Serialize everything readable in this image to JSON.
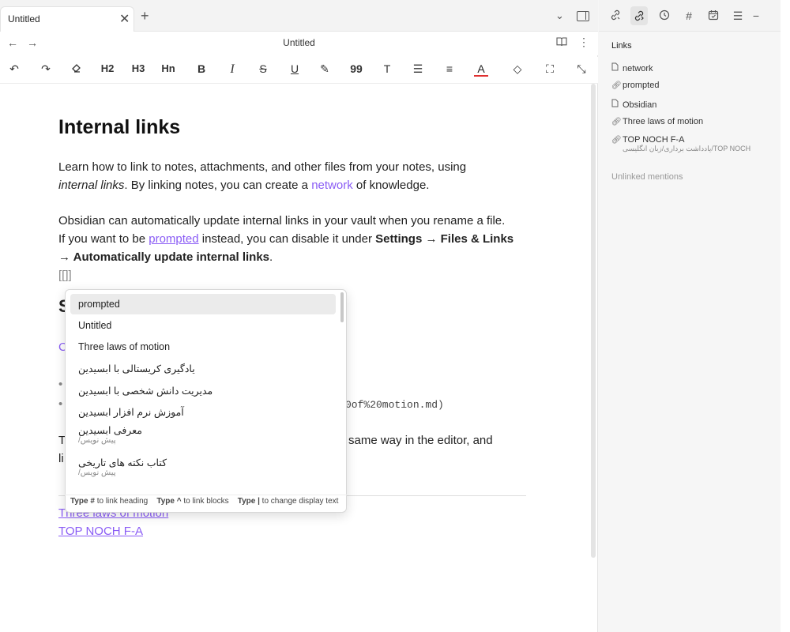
{
  "tab": {
    "title": "Untitled",
    "close_glyph": "✕",
    "new_glyph": "+"
  },
  "nav": {
    "title": "Untitled",
    "back_glyph": "←",
    "forward_glyph": "→",
    "more_glyph": "⋮"
  },
  "toolbar": {
    "undo": "↶",
    "redo": "↷",
    "clear": "⌫",
    "h2": "H2",
    "h3": "H3",
    "hn": "Hn",
    "bold": "B",
    "italic": "I",
    "strike": "S",
    "underline": "U",
    "highlight": "✎",
    "quote": "99",
    "text": "T",
    "list": "☰",
    "align": "≡",
    "color": "A",
    "fill": "◇",
    "expand": "⛶",
    "collapse": "⤡"
  },
  "doc": {
    "heading": "Internal links",
    "p1_line1": "Learn how to link to notes, attachments, and other files from your notes, using",
    "p1_line2_a": "internal links",
    "p1_line2_b": ". By linking notes, you can create a ",
    "p1_line2_link": "network",
    "p1_line2_c": " of knowledge.",
    "p2_line1": "Obsidian can automatically update internal links in your vault when you rename a file.",
    "p2_line2_a": "If you want to be ",
    "p2_line2_link": "prompted",
    "p2_line2_b": " instead, you can disable it under ",
    "p2_line2_bold": "Settings → Files & Links",
    "p2_line3_bold": "→ Automatically update internal links",
    "p2_line3_c": ".",
    "bracket": "[[]]",
    "hidden_heading_initial": "S",
    "hidden_link_initial": "C",
    "mono_tail": "0of%20motion.md)",
    "p3_initial": "T",
    "p3_tail": "same way in the editor, and",
    "p3_line2_initial": "li",
    "link_a": "Three laws of motion",
    "link_b": "TOP NOCH F-A"
  },
  "popup": {
    "items": [
      {
        "label": "prompted",
        "sub": "",
        "rtl": false
      },
      {
        "label": "Untitled",
        "sub": "",
        "rtl": false
      },
      {
        "label": "Three laws of motion",
        "sub": "",
        "rtl": false
      },
      {
        "label": "یادگیری کریستالی با ابسیدین",
        "sub": "",
        "rtl": true
      },
      {
        "label": "مدیریت دانش شخصی با ابسیدین",
        "sub": "",
        "rtl": true
      },
      {
        "label": "آموزش نرم افزار ابسیدین",
        "sub": "",
        "rtl": true
      },
      {
        "label": "معرفی ابسیدین",
        "sub": "پیش نویس/",
        "rtl": true
      },
      {
        "label": "کتاب نکته های تاریخی",
        "sub": "پیش نویس/",
        "rtl": true
      }
    ],
    "hint1_key": "Type #",
    "hint1_text": " to link heading",
    "hint2_key": "Type ^",
    "hint2_text": " to link blocks",
    "hint3_key": "Type |",
    "hint3_text": " to change display text"
  },
  "sidebar": {
    "header": "Links",
    "items": [
      {
        "icon": "file-icon",
        "label": "network"
      },
      {
        "icon": "link-icon",
        "label": "prompted"
      },
      {
        "icon": "file-icon",
        "label": "Obsidian"
      },
      {
        "icon": "link-icon",
        "label": "Three laws of motion"
      },
      {
        "icon": "link-icon",
        "label": "TOP NOCH F-A",
        "sub": "TOP NOCH/یادداشت برداری/زبان انگلیسی"
      }
    ],
    "unlinked": "Unlinked mentions",
    "top_icons": [
      "backlinks-icon",
      "outgoing-links-icon",
      "clock-icon",
      "tag-icon",
      "calendar-icon",
      "outline-icon",
      "minimize-icon"
    ]
  },
  "colors": {
    "accent": "#8a5cf5",
    "active_bg": "#ebebeb"
  }
}
